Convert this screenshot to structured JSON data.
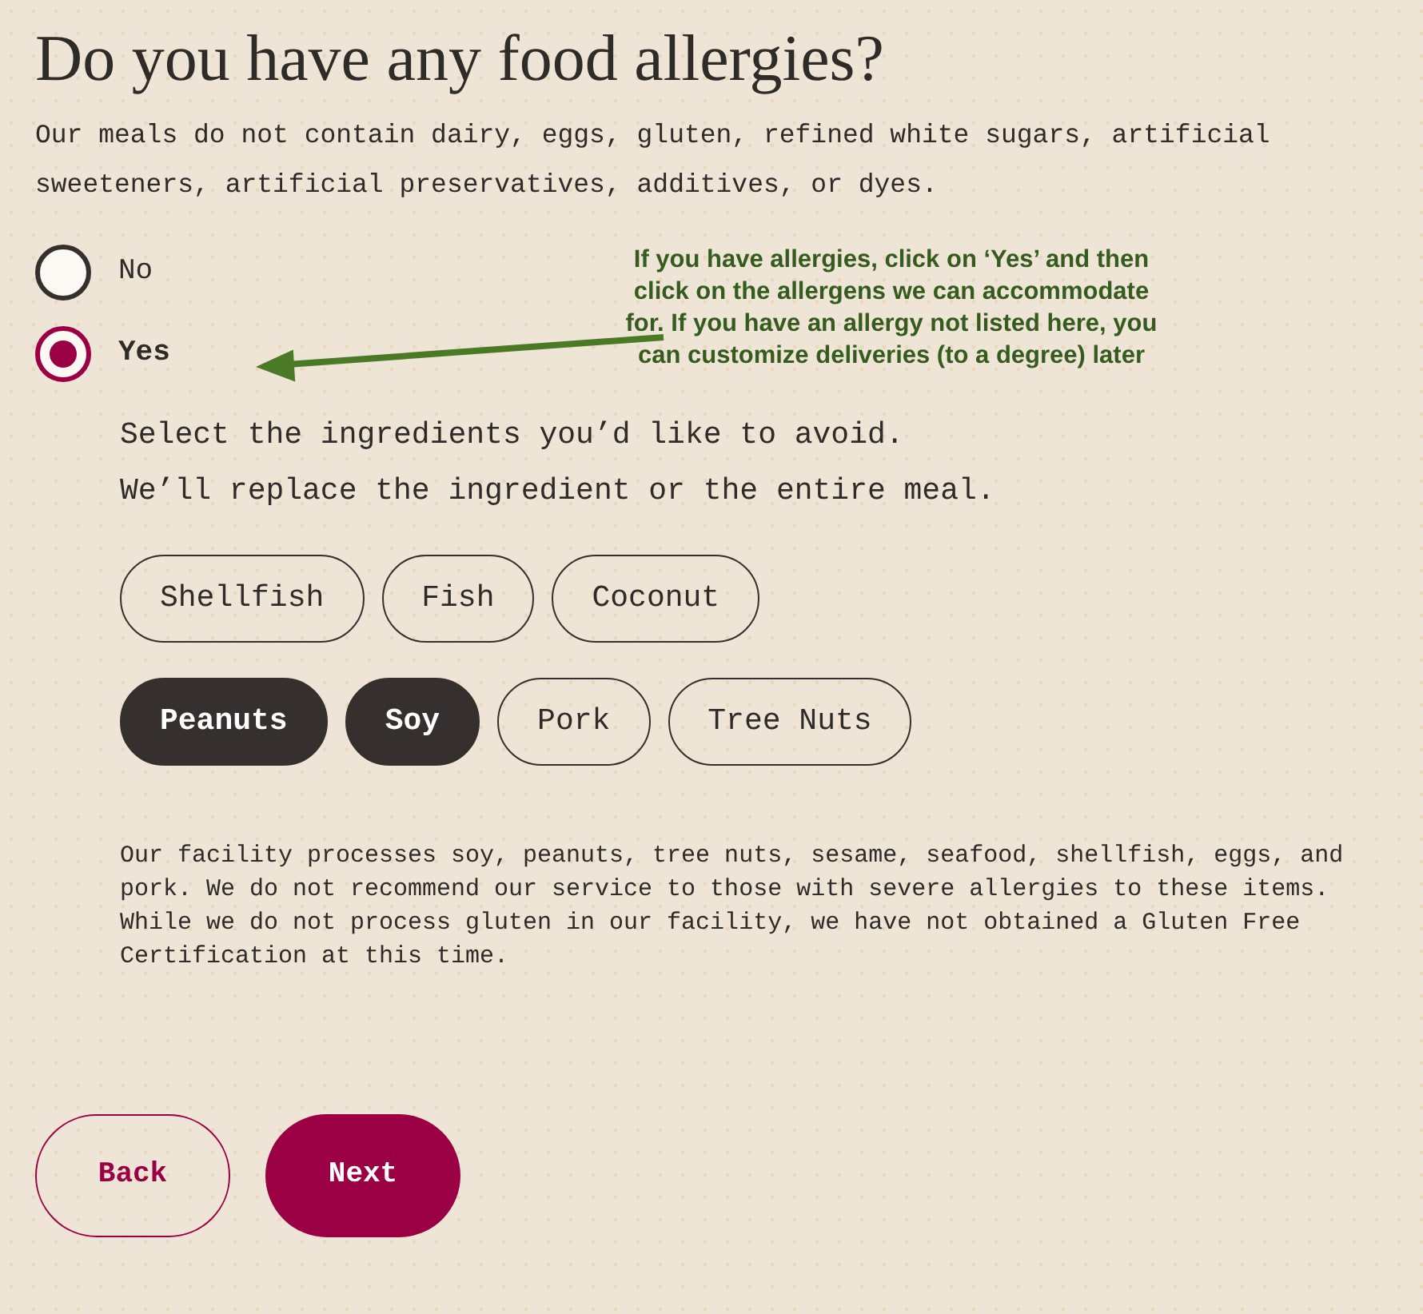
{
  "title": "Do you have any food allergies?",
  "intro": "Our meals do not contain dairy, eggs, gluten, refined white sugars, artificial sweeteners, artificial preservatives, additives, or dyes.",
  "options": [
    {
      "label": "No",
      "selected": false
    },
    {
      "label": "Yes",
      "selected": true
    }
  ],
  "annotation": "If you have allergies, click on ‘Yes’ and then click on the allergens we can accommodate for. If you have an allergy not listed here, you can customize deliveries (to a degree) later",
  "prompt": [
    "Select the ingredients you’d like to avoid.",
    "We’ll replace the ingredient or the entire meal."
  ],
  "allergen_rows": [
    [
      {
        "label": "Shellfish",
        "selected": false
      },
      {
        "label": "Fish",
        "selected": false
      },
      {
        "label": "Coconut",
        "selected": false
      }
    ],
    [
      {
        "label": "Peanuts",
        "selected": true
      },
      {
        "label": "Soy",
        "selected": true
      },
      {
        "label": "Pork",
        "selected": false
      },
      {
        "label": "Tree Nuts",
        "selected": false
      }
    ]
  ],
  "note": "Our facility processes soy, peanuts, tree nuts, sesame, seafood, shellfish, eggs, and pork. We do not recommend our service to those with severe allergies to these items. While we do not process gluten in our facility, we have not obtained a Gluten Free Certification at this time.",
  "buttons": [
    {
      "label": "Back",
      "kind": "secondary"
    },
    {
      "label": "Next",
      "kind": "primary"
    }
  ]
}
